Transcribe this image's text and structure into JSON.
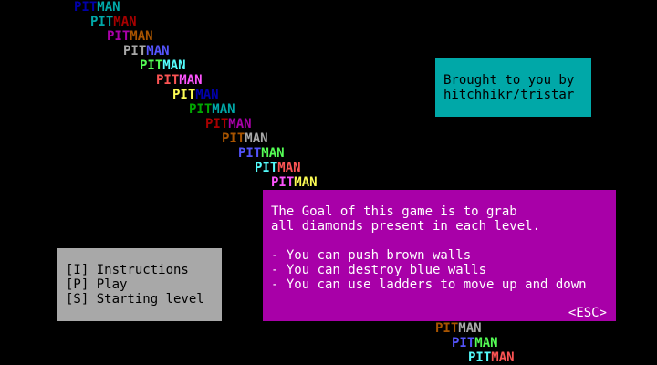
{
  "logo_rows": [
    {
      "pit": "PIT",
      "man": "MAN",
      "pit_color": "#0000a8",
      "man_color": "#00a8a8"
    },
    {
      "pit": "PIT",
      "man": "MAN",
      "pit_color": "#00a8a8",
      "man_color": "#a80000"
    },
    {
      "pit": "PIT",
      "man": "MAN",
      "pit_color": "#a800a8",
      "man_color": "#a85400"
    },
    {
      "pit": "PIT",
      "man": "MAN",
      "pit_color": "#a8a8a8",
      "man_color": "#5454fc"
    },
    {
      "pit": "PIT",
      "man": "MAN",
      "pit_color": "#54fc54",
      "man_color": "#54fcfc"
    },
    {
      "pit": "PIT",
      "man": "MAN",
      "pit_color": "#fc5454",
      "man_color": "#fc54fc"
    },
    {
      "pit": "PIT",
      "man": "MAN",
      "pit_color": "#fcfc54",
      "man_color": "#0000a8"
    },
    {
      "pit": "PIT",
      "man": "MAN",
      "pit_color": "#00a800",
      "man_color": "#00a8a8"
    },
    {
      "pit": "PIT",
      "man": "MAN",
      "pit_color": "#a80000",
      "man_color": "#a800a8"
    },
    {
      "pit": "PIT",
      "man": "MAN",
      "pit_color": "#a85400",
      "man_color": "#a8a8a8"
    },
    {
      "pit": "PIT",
      "man": "MAN",
      "pit_color": "#5454fc",
      "man_color": "#54fc54"
    },
    {
      "pit": "PIT",
      "man": "MAN",
      "pit_color": "#54fcfc",
      "man_color": "#fc5454"
    },
    {
      "pit": "PIT",
      "man": "MAN",
      "pit_color": "#fc54fc",
      "man_color": "#fcfc54"
    },
    {
      "pit": "PIT",
      "man": "MAN",
      "pit_color": "#a85400",
      "man_color": "#a8a8a8"
    },
    {
      "pit": "PIT",
      "man": "MAN",
      "pit_color": "#5454fc",
      "man_color": "#54fc54"
    },
    {
      "pit": "PIT",
      "man": "MAN",
      "pit_color": "#54fcfc",
      "man_color": "#fc5454"
    }
  ],
  "credits": {
    "line1": "Brought to you by",
    "line2": "hitchhikr/tristar"
  },
  "menu": {
    "instructions": "[I] Instructions",
    "play": "[P] Play",
    "starting_level": "[S] Starting level"
  },
  "goal": {
    "line1": "The Goal of this game is to grab",
    "line2": "all diamonds present in each level.",
    "bullet1": "- You can push brown walls",
    "bullet2": "- You can destroy blue walls",
    "bullet3": "- You can use ladders to move up and down",
    "esc": "<ESC>"
  },
  "colors": {
    "background": "#000000",
    "credits_panel": "#00a8a8",
    "menu_panel": "#a8a8a8",
    "goal_panel": "#a800a8"
  }
}
